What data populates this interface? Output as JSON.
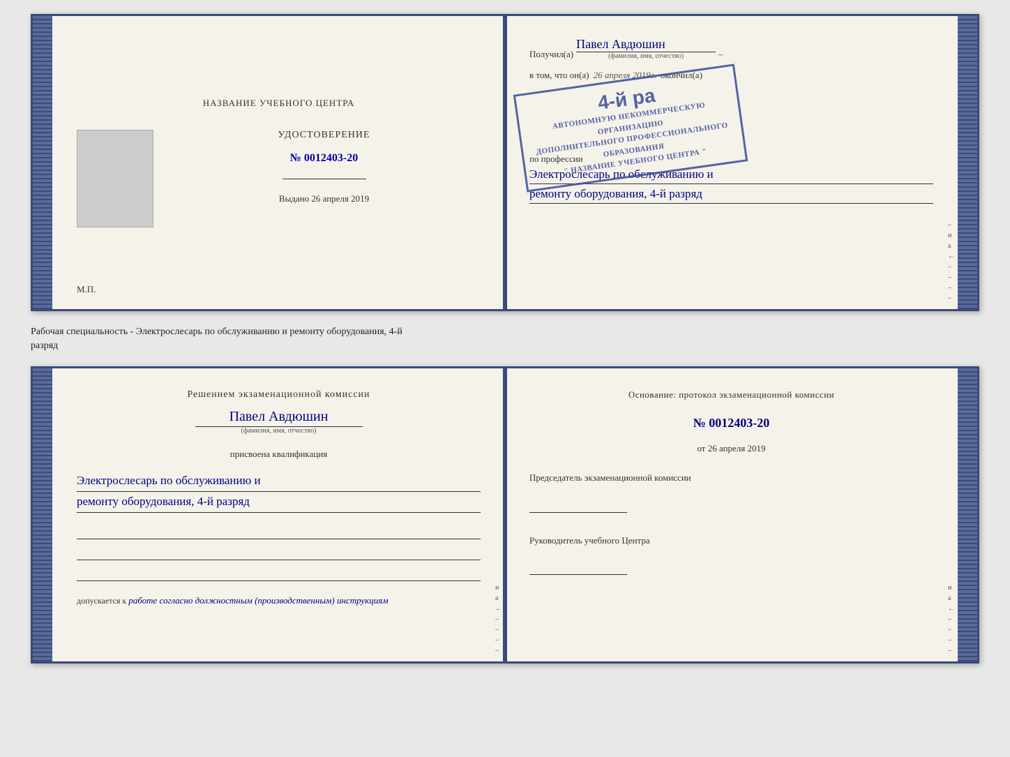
{
  "top_booklet": {
    "left": {
      "center_title": "НАЗВАНИЕ УЧЕБНОГО ЦЕНТРА",
      "cert_label": "УДОСТОВЕРЕНИЕ",
      "cert_number": "№ 0012403-20",
      "issued_label": "Выдано",
      "issued_date": "26 апреля 2019",
      "mp_label": "М.П."
    },
    "right": {
      "received_prefix": "Получил(а)",
      "recipient_name": "Павел Авдюшин",
      "fio_label": "(фамилия, имя, отчество)",
      "in_that_prefix": "в том, что он(а)",
      "completion_date": "26 апреля 2019г.",
      "finished_label": "окончил(а)",
      "stamp_line1": "АВТОНОМНУЮ НЕКОММЕРЧЕСКУЮ ОРГАНИЗАЦИЮ",
      "stamp_line2": "ДОПОЛНИТЕЛЬНОГО ПРОФЕССИОНАЛЬНОГО ОБРАЗОВАНИЯ",
      "stamp_line3": "\" НАЗВАНИЕ УЧЕБНОГО ЦЕНТРА \"",
      "stamp_big_number": "4-й ра",
      "profession_prefix": "по профессии",
      "profession_line1": "Электрослесарь по обслуживанию и",
      "profession_line2": "ремонту оборудования, 4-й разряд"
    }
  },
  "separator": {
    "text_line1": "Рабочая специальность - Электрослесарь по обслуживанию и ремонту оборудования, 4-й",
    "text_line2": "разряд"
  },
  "bottom_booklet": {
    "left": {
      "commission_title": "Решением экзаменационной комиссии",
      "person_name": "Павел Авдюшин",
      "fio_label": "(фамилия, имя, отчество)",
      "assigned_label": "присвоена квалификация",
      "qualification_line1": "Электрослесарь по обслуживанию и",
      "qualification_line2": "ремонту оборудования, 4-й разряд",
      "allowed_prefix": "допускается к",
      "allowed_text": "работе согласно должностным (производственным) инструкциям"
    },
    "right": {
      "basis_label": "Основание: протокол экзаменационной комиссии",
      "basis_number": "№ 0012403-20",
      "basis_date_prefix": "от",
      "basis_date": "26 апреля 2019",
      "chairman_label": "Председатель экзаменационной комиссии",
      "director_label": "Руководитель учебного Центра"
    }
  },
  "side_marks": [
    "и",
    "а",
    "←",
    "–",
    "–",
    "–",
    "–"
  ]
}
